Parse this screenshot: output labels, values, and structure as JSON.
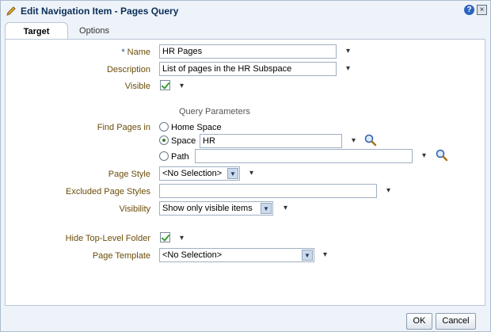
{
  "dialog": {
    "title": "Edit Navigation Item - Pages Query",
    "help": "?",
    "close": "×"
  },
  "tabs": [
    {
      "label": "Target",
      "active": true
    },
    {
      "label": "Options",
      "active": false
    }
  ],
  "form": {
    "name": {
      "required_mark": "*",
      "label": "Name",
      "value": "HR Pages"
    },
    "description": {
      "label": "Description",
      "value": "List of pages in the HR Subspace"
    },
    "visible": {
      "label": "Visible",
      "checked": true
    },
    "query_parameters_title": "Query Parameters",
    "find_pages_in": {
      "label": "Find Pages in",
      "options": [
        {
          "label": "Home Space",
          "selected": false
        },
        {
          "label": "Space",
          "selected": true,
          "value": "HR"
        },
        {
          "label": "Path",
          "selected": false,
          "value": ""
        }
      ]
    },
    "page_style": {
      "label": "Page Style",
      "value": "<No Selection>"
    },
    "excluded_page_styles": {
      "label": "Excluded Page Styles",
      "value": ""
    },
    "visibility": {
      "label": "Visibility",
      "value": "Show only visible items"
    },
    "hide_top_level_folder": {
      "label": "Hide Top-Level Folder",
      "checked": true
    },
    "page_template": {
      "label": "Page Template",
      "value": "<No Selection>"
    }
  },
  "buttons": {
    "ok": "OK",
    "cancel": "Cancel"
  },
  "icons": {
    "chevron": "chevron-down-icon",
    "search": "search-icon",
    "title": "pencil-icon",
    "check_color": "#3c9d35"
  }
}
